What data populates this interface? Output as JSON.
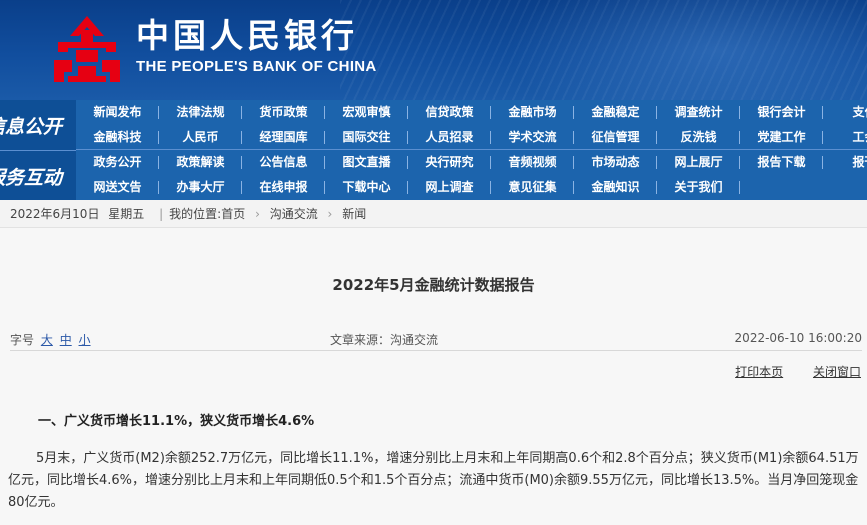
{
  "header": {
    "bank_name_cn": "中国人民银行",
    "bank_name_en": "THE PEOPLE'S BANK OF CHINA"
  },
  "nav": {
    "section1_label": "信息公开",
    "section2_label": "服务互动",
    "rows": [
      [
        "新闻发布",
        "法律法规",
        "货币政策",
        "宏观审慎",
        "信贷政策",
        "金融市场",
        "金融稳定",
        "调查统计",
        "银行会计",
        "支付"
      ],
      [
        "金融科技",
        "人民币",
        "经理国库",
        "国际交往",
        "人员招录",
        "学术交流",
        "征信管理",
        "反洗钱",
        "党建工作",
        "工会"
      ],
      [
        "政务公开",
        "政策解读",
        "公告信息",
        "图文直播",
        "央行研究",
        "音频视频",
        "市场动态",
        "网上展厅",
        "报告下载",
        "报刊"
      ],
      [
        "网送文告",
        "办事大厅",
        "在线申报",
        "下载中心",
        "网上调查",
        "意见征集",
        "金融知识",
        "关于我们"
      ]
    ]
  },
  "breadcrumb": {
    "date": "2022年6月10日",
    "weekday": "星期五",
    "location_label": "我的位置:",
    "items": [
      "首页",
      "沟通交流",
      "新闻"
    ]
  },
  "article": {
    "title": "2022年5月金融统计数据报告",
    "font_size_label": "字号",
    "font_size_options": [
      "大",
      "中",
      "小"
    ],
    "source": "文章来源：沟通交流",
    "datetime": "2022-06-10  16:00:20",
    "print_label": "打印本页",
    "close_label": "关闭窗口",
    "section_heading": "一、广义货币增长11.1%，狭义货币增长4.6%",
    "paragraph": "5月末，广义货币(M2)余额252.7万亿元，同比增长11.1%，增速分别比上月末和上年同期高0.6个和2.8个百分点；狭义货币(M1)余额64.51万亿元，同比增长4.6%，增速分别比上月末和上年同期低0.5个和1.5个百分点；流通中货币(M0)余额9.55万亿元，同比增长13.5%。当月净回笼现金80亿元。"
  }
}
